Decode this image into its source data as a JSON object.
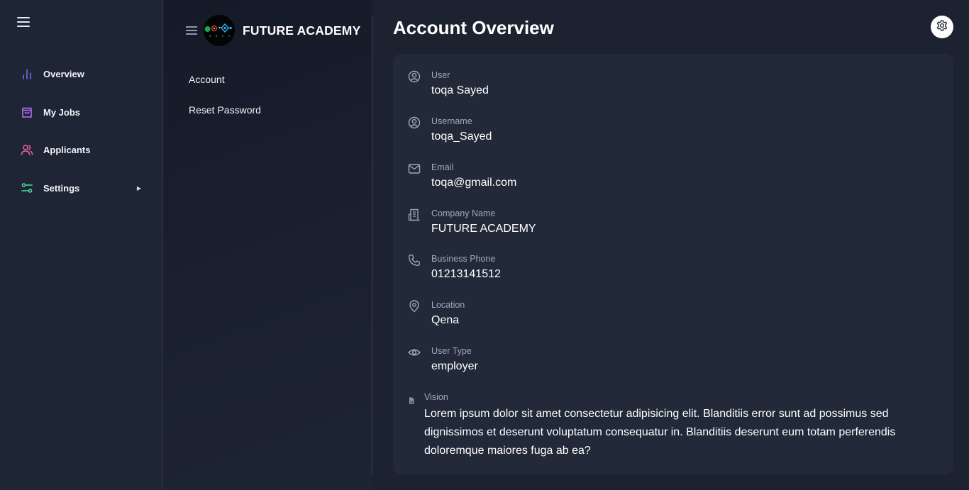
{
  "sidebar": {
    "items": [
      {
        "label": "Overview",
        "icon": "bar-chart-icon",
        "color": "#6a6ff0"
      },
      {
        "label": "My Jobs",
        "icon": "shopping-bag-icon",
        "color": "#b872ff"
      },
      {
        "label": "Applicants",
        "icon": "users-icon",
        "color": "#f0609b"
      },
      {
        "label": "Settings",
        "icon": "sliders-icon",
        "color": "#4ee0a6"
      }
    ]
  },
  "brand": {
    "name": "FUTURE ACADEMY"
  },
  "submenu": {
    "items": [
      {
        "label": "Account"
      },
      {
        "label": "Reset Password"
      }
    ]
  },
  "page": {
    "title": "Account Overview"
  },
  "account": {
    "fields": [
      {
        "label": "User",
        "value": "toqa Sayed",
        "icon": "user-circle-icon"
      },
      {
        "label": "Username",
        "value": "toqa_Sayed",
        "icon": "user-circle-icon"
      },
      {
        "label": "Email",
        "value": "toqa@gmail.com",
        "icon": "mail-icon"
      },
      {
        "label": "Company Name",
        "value": "FUTURE ACADEMY",
        "icon": "building-icon"
      },
      {
        "label": "Business Phone",
        "value": "01213141512",
        "icon": "phone-icon"
      },
      {
        "label": "Location",
        "value": "Qena",
        "icon": "map-pin-icon"
      },
      {
        "label": "User Type",
        "value": "employer",
        "icon": "eye-icon"
      }
    ],
    "vision": {
      "label": "Vision",
      "text": "Lorem ipsum dolor sit amet consectetur adipisicing elit. Blanditiis error sunt ad possimus sed dignissimos et deserunt voluptatum consequatur in. Blanditiis deserunt eum totam perferendis doloremque maiores fuga ab ea?",
      "icon": "document-icon"
    }
  }
}
